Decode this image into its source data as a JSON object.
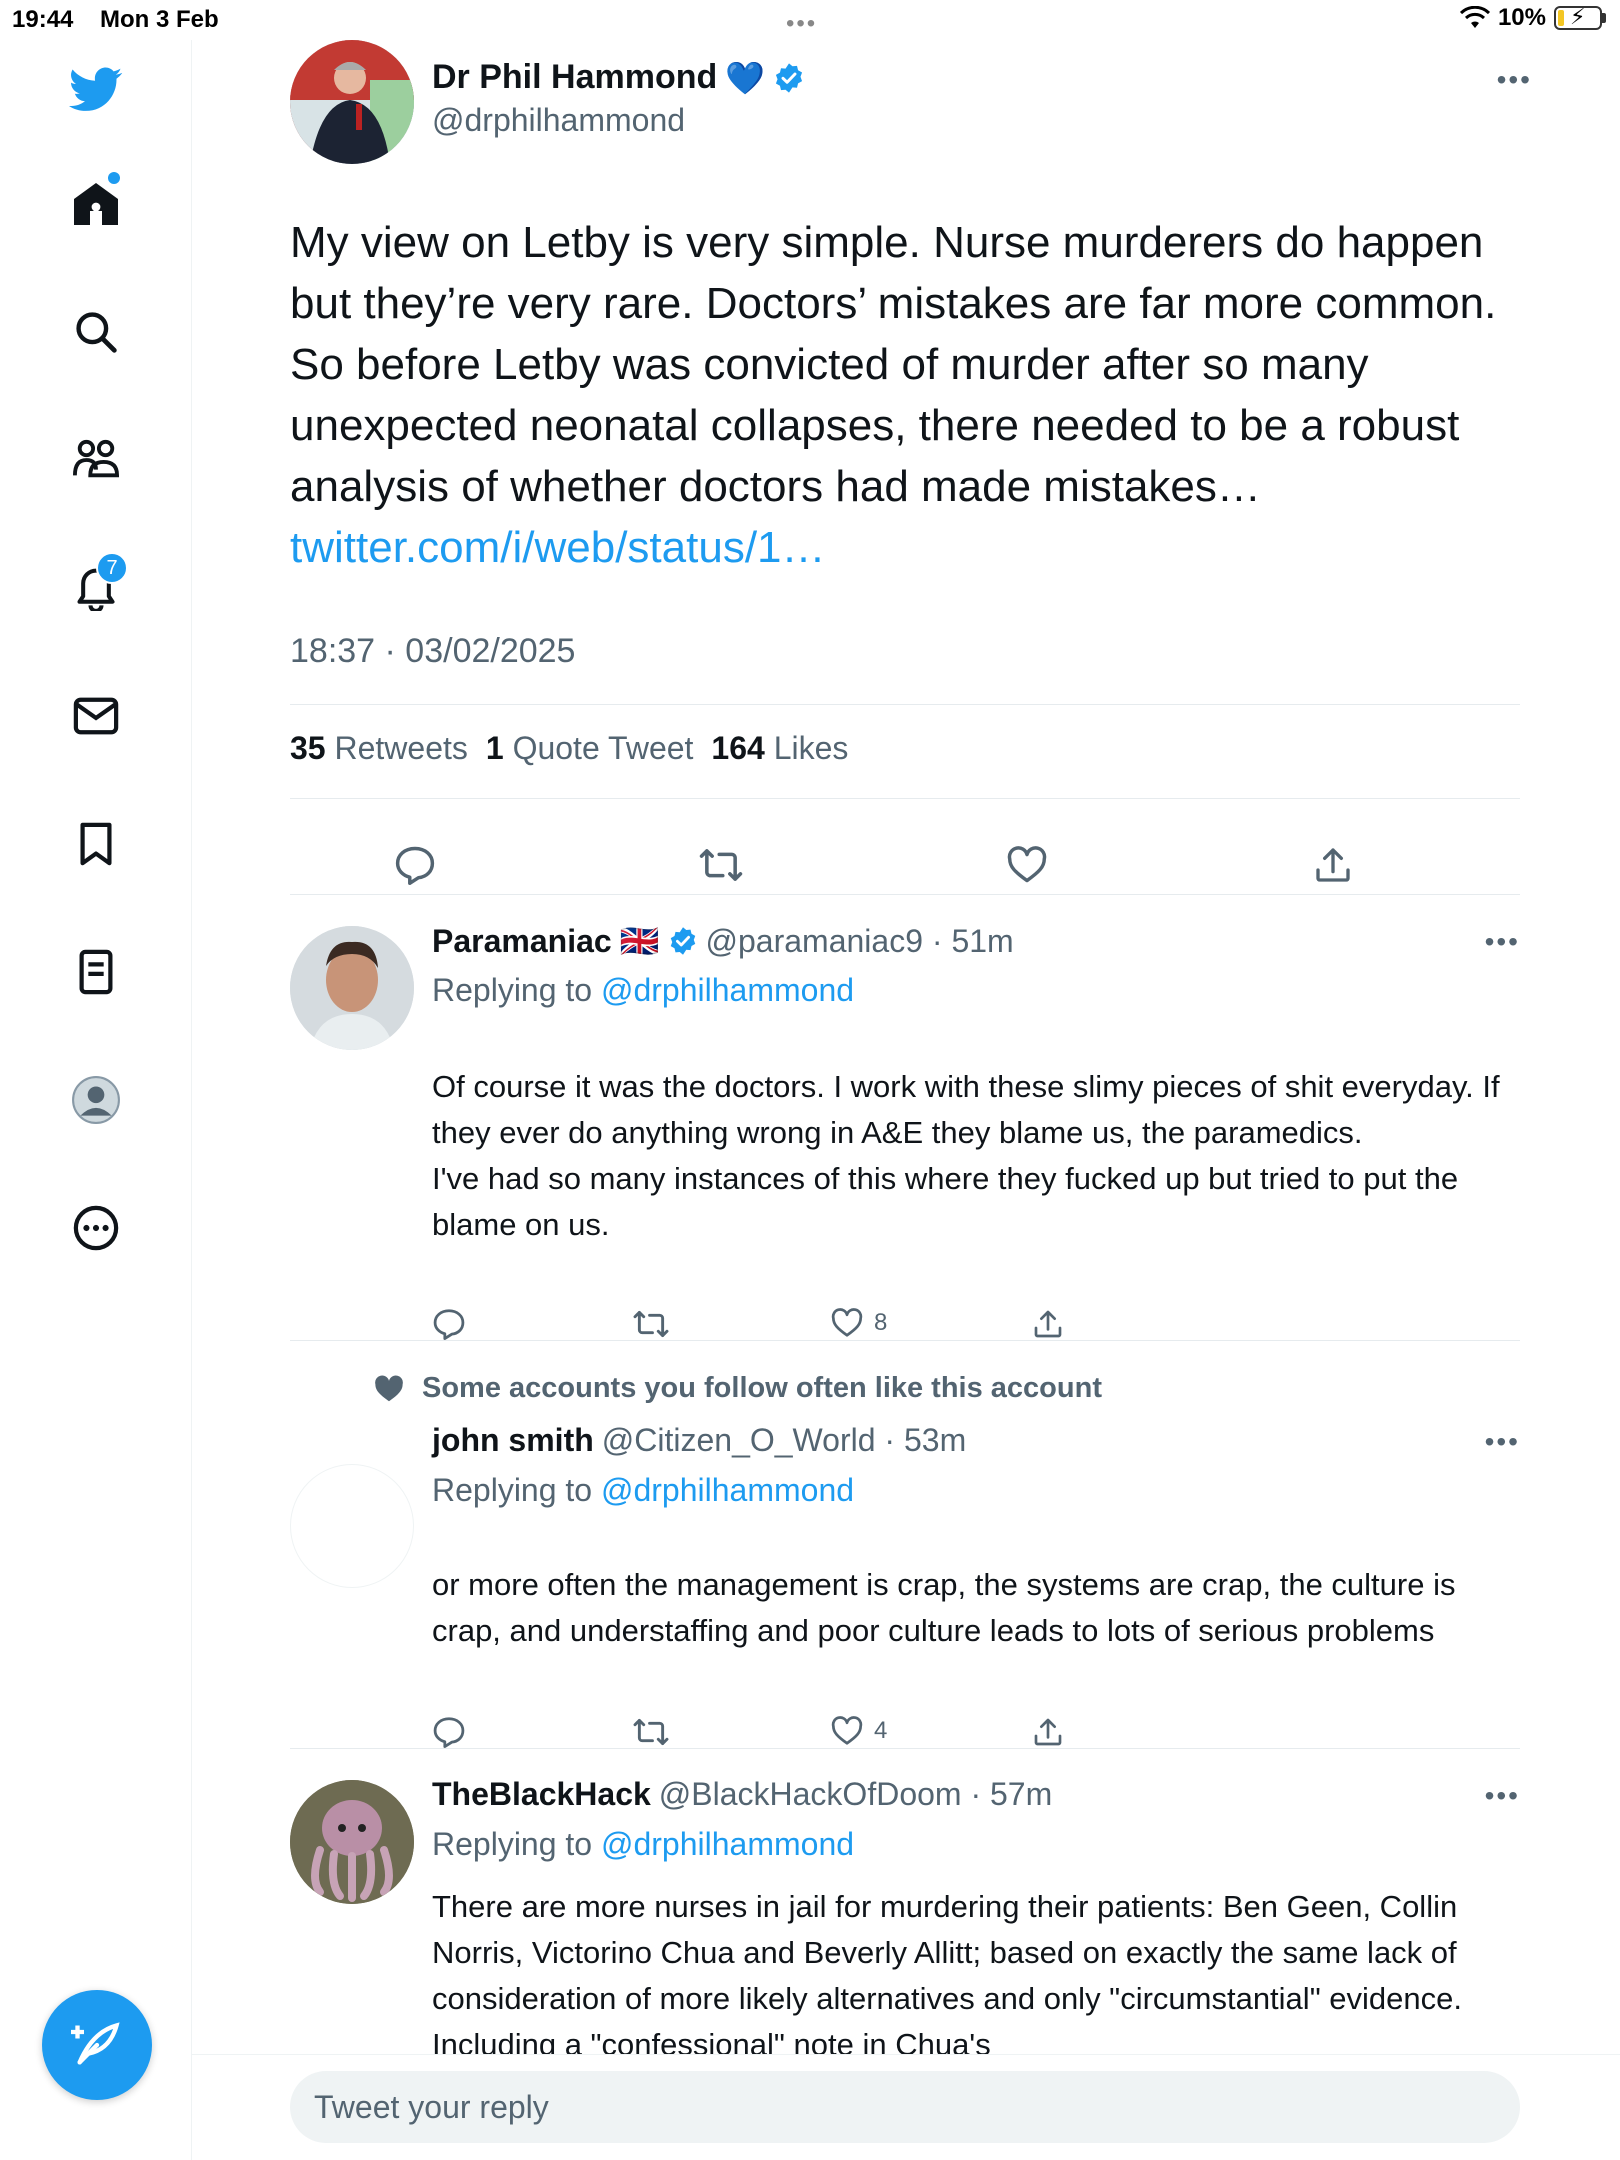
{
  "status_bar": {
    "time": "19:44",
    "date": "Mon 3 Feb",
    "battery": "10%"
  },
  "sidebar": {
    "items": [
      {
        "name": "twitter-logo-icon"
      },
      {
        "name": "home-icon"
      },
      {
        "name": "explore-icon"
      },
      {
        "name": "communities-icon"
      },
      {
        "name": "notifications-icon",
        "badge": "7"
      },
      {
        "name": "messages-icon"
      },
      {
        "name": "bookmarks-icon"
      },
      {
        "name": "lists-icon"
      },
      {
        "name": "profile-icon"
      },
      {
        "name": "more-icon"
      }
    ]
  },
  "tweet": {
    "author_name": "Dr Phil Hammond",
    "author_emoji": "💙",
    "handle": "@drphilhammond",
    "text": "My view on Letby is very simple. Nurse murderers do happen but they’re very rare. Doctors’ mistakes are far more common. So before Letby was convicted of murder after so many unexpected neonatal collapses, there needed to be a robust analysis of whether doctors had made mistakes… ",
    "link": "twitter.com/i/web/status/1…",
    "timestamp": "18:37 · 03/02/2025",
    "retweets_count": "35",
    "retweets_label": "Retweets",
    "quotes_count": "1",
    "quotes_label": "Quote Tweet",
    "likes_count": "164",
    "likes_label": "Likes"
  },
  "replies": [
    {
      "name": "Paramaniac",
      "flag": "🇬🇧",
      "handle": "@paramaniac9 · 51m",
      "replying_prefix": "Replying to ",
      "replying_to": "@drphilhammond",
      "text": "Of course it was the doctors. I work with these slimy pieces of shit everyday. If they ever do anything wrong in A&E they blame us, the paramedics.\nI've had so many instances of this where they fucked up but tried to put the blame on us.",
      "likes": "8"
    },
    {
      "context": "Some accounts you follow often like this account",
      "name": "john smith",
      "handle": "@Citizen_O_World · 53m",
      "replying_prefix": "Replying to ",
      "replying_to": "@drphilhammond",
      "text": "or more often the management is crap, the systems are crap, the culture is crap, and understaffing and poor culture leads to lots of serious problems",
      "likes": "4"
    },
    {
      "name": "TheBlackHack",
      "handle": "@BlackHackOfDoom · 57m",
      "replying_prefix": "Replying to ",
      "replying_to": "@drphilhammond",
      "text": "There are more nurses in jail for murdering their patients: Ben Geen, Collin Norris, Victorino Chua and Beverly Allitt; based on exactly the same lack of consideration of more likely alternatives and only \"circumstantial\" evidence. Including a \"confessional\" note in Chua's"
    }
  ],
  "reply_bar": {
    "placeholder": "Tweet your reply"
  },
  "colors": {
    "accent": "#1d9bf0",
    "text": "#0f1419",
    "secondary": "#536471"
  }
}
